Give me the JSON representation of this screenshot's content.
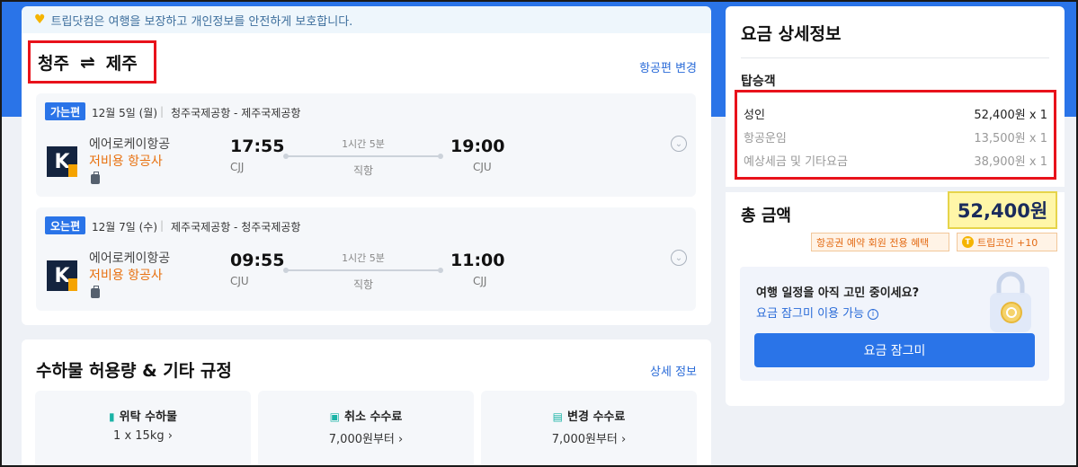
{
  "notice": {
    "text": "트립닷컴은 여행을 보장하고 개인정보를 안전하게 보호합니다."
  },
  "route": {
    "origin": "청주",
    "destination": "제주",
    "arrow": "⇌",
    "change_link": "항공편 변경"
  },
  "legs": [
    {
      "badge": "가는편",
      "date": "12월 5일 (월)",
      "airports": "청주국제공항 - 제주국제공항",
      "airline": "에어로케이항공",
      "carrier_type": "저비용 항공사",
      "dep_time": "17:55",
      "dep_code": "CJJ",
      "duration": "1시간 5분",
      "stops": "직항",
      "arr_time": "19:00",
      "arr_code": "CJU"
    },
    {
      "badge": "오는편",
      "date": "12월 7일 (수)",
      "airports": "제주국제공항 - 청주국제공항",
      "airline": "에어로케이항공",
      "carrier_type": "저비용 항공사",
      "dep_time": "09:55",
      "dep_code": "CJU",
      "duration": "1시간 5분",
      "stops": "직항",
      "arr_time": "11:00",
      "arr_code": "CJJ"
    }
  ],
  "baggage": {
    "title": "수하물 허용량 & 기타 규정",
    "detail_link": "상세 정보",
    "policies": [
      {
        "label": "위탁 수하물",
        "value": "1 x 15kg",
        "icon": "luggage-icon"
      },
      {
        "label": "취소 수수료",
        "value": "7,000원부터",
        "icon": "ticket-icon"
      },
      {
        "label": "변경 수수료",
        "value": "7,000원부터",
        "icon": "calendar-icon"
      }
    ]
  },
  "fare": {
    "title": "요금 상세정보",
    "passenger_heading": "탑승객",
    "rows": [
      {
        "label": "성인",
        "value": "52,400원 x 1"
      },
      {
        "label": "항공운임",
        "value": "13,500원 x 1"
      },
      {
        "label": "예상세금 및 기타요금",
        "value": "38,900원 x 1"
      }
    ],
    "total_label": "총 금액",
    "total_value": "52,400원",
    "member_tag": "항공권 예약 회원 전용 혜택",
    "coin_tag": "트립코인 +10",
    "lock_question": "여행 일정을 아직 고민 중이세요?",
    "lock_info": "요금 잠그미 이용 가능",
    "lock_button": "요금 잠그미"
  },
  "colors": {
    "brand_blue": "#2a74e8",
    "highlight_red": "#e8121b",
    "lcc_orange": "#e8700e",
    "total_yellow": "#fff6a8"
  }
}
